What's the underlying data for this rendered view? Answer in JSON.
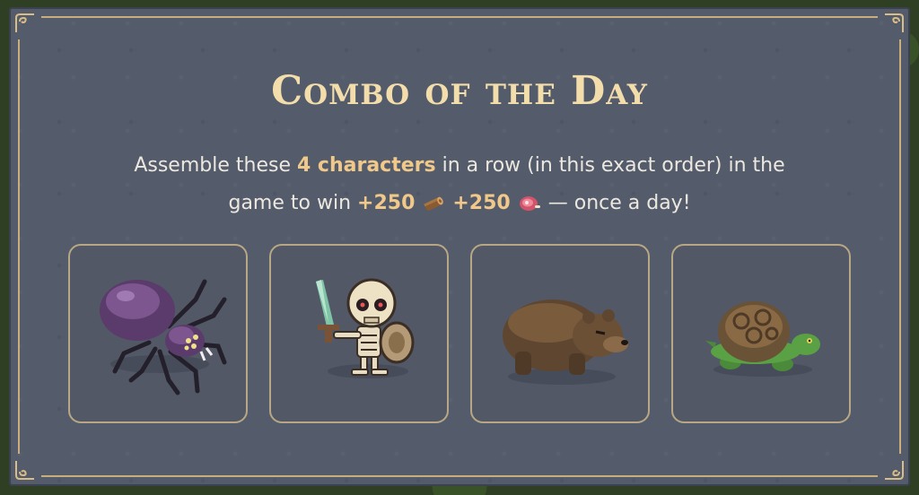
{
  "title": "Combo of the Day",
  "description": {
    "part1": "Assemble these ",
    "highlight": "4 characters",
    "part2": " in a row (in this exact order) in the",
    "part3": "game to win ",
    "reward1": "+250",
    "reward1_icon": "wood-log-icon",
    "reward2": "+250",
    "reward2_icon": "meat-icon",
    "part4": " — once a day!"
  },
  "characters": [
    {
      "name": "spider",
      "icon": "spider-icon"
    },
    {
      "name": "skeleton",
      "icon": "skeleton-icon"
    },
    {
      "name": "bear",
      "icon": "bear-icon"
    },
    {
      "name": "turtle",
      "icon": "turtle-icon"
    }
  ],
  "colors": {
    "panel": "#545b6b",
    "title": "#f3ddaa",
    "highlight": "#f0c98a",
    "border": "#c9ad7a",
    "card_border": "#b8a785"
  }
}
